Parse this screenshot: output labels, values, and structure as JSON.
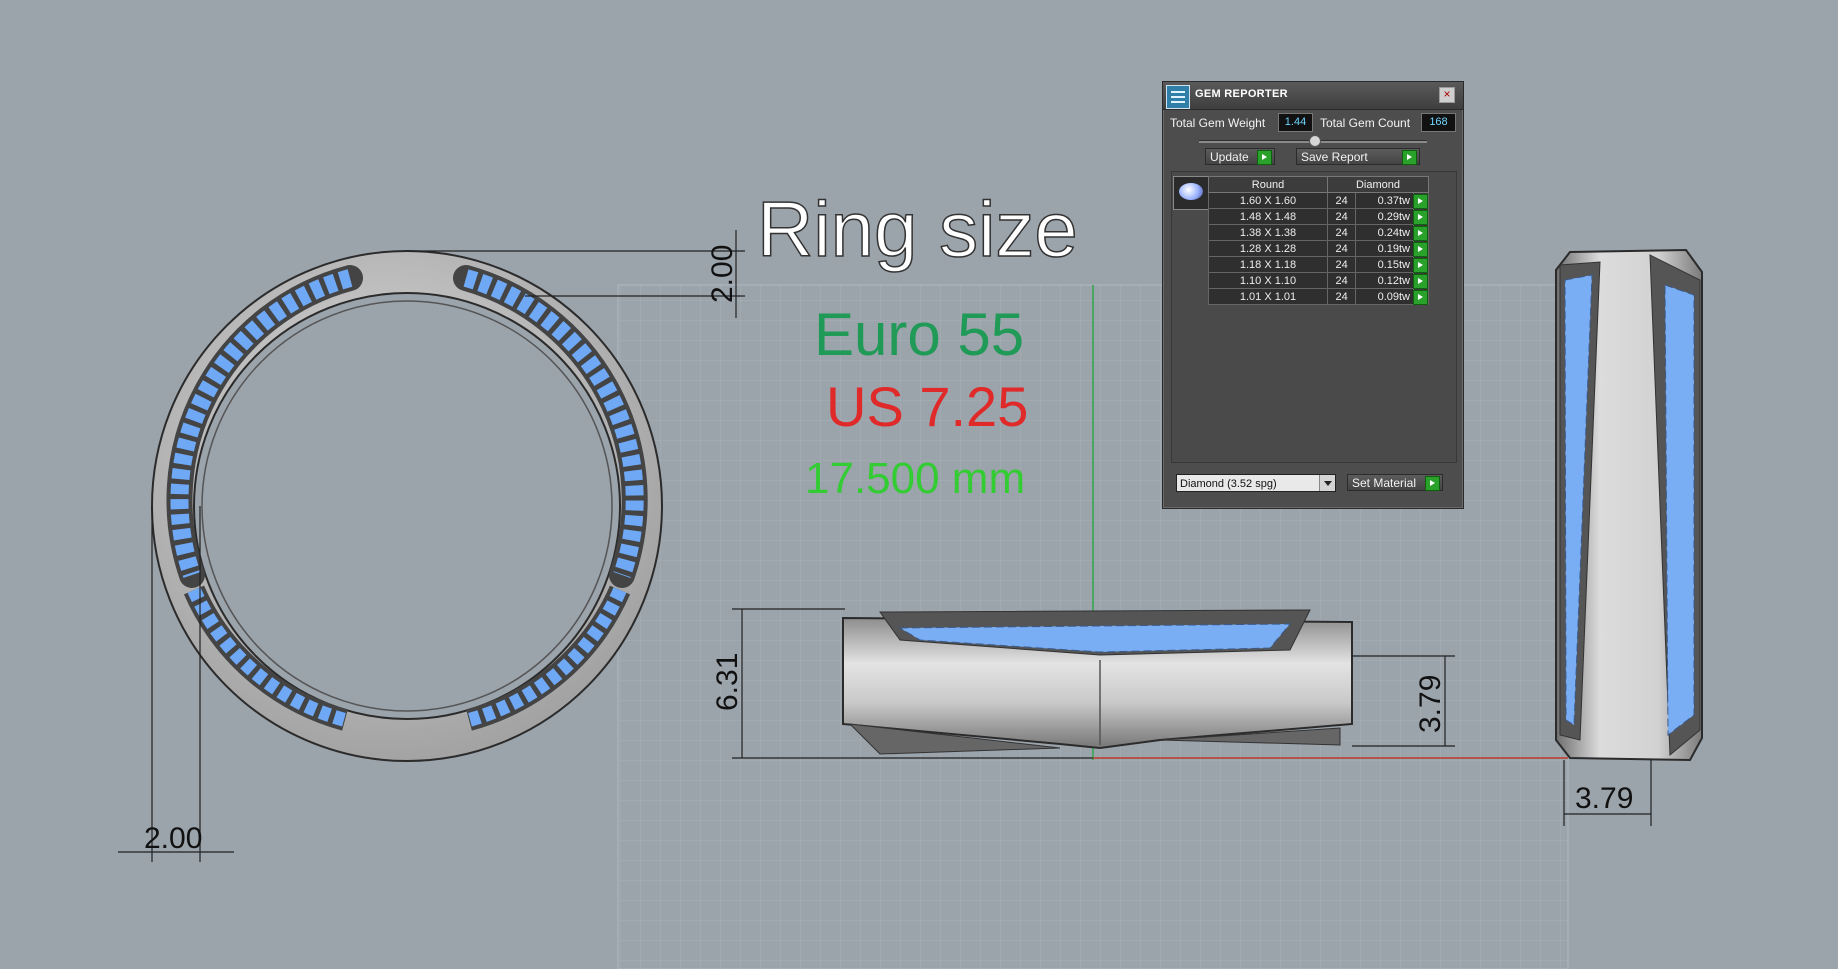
{
  "viewport": {
    "title_text": "Ring size",
    "euro_size": "Euro 55",
    "us_size": "US 7.25",
    "diameter": "17.500 mm",
    "colors": {
      "euro": "#1f9a57",
      "us": "#e02a2a",
      "diameter": "#33cc33",
      "background": "#9ba3ab"
    },
    "dimensions": {
      "top_wall": "2.00",
      "front_width": "2.00",
      "height": "6.31",
      "side_height": "3.79",
      "side_width": "3.79"
    }
  },
  "gem_reporter": {
    "title": "GEM REPORTER",
    "total_weight_label": "Total Gem Weight",
    "total_weight_value": "1.44",
    "total_count_label": "Total Gem Count",
    "total_count_value": "168",
    "update_label": "Update",
    "save_report_label": "Save Report",
    "table": {
      "headers": [
        "Round",
        "Diamond"
      ],
      "rows": [
        {
          "size": "1.60 X 1.60",
          "count": "24",
          "tw": "0.37tw"
        },
        {
          "size": "1.48 X 1.48",
          "count": "24",
          "tw": "0.29tw"
        },
        {
          "size": "1.38 X 1.38",
          "count": "24",
          "tw": "0.24tw"
        },
        {
          "size": "1.28 X 1.28",
          "count": "24",
          "tw": "0.19tw"
        },
        {
          "size": "1.18 X 1.18",
          "count": "24",
          "tw": "0.15tw"
        },
        {
          "size": "1.10 X 1.10",
          "count": "24",
          "tw": "0.12tw"
        },
        {
          "size": "1.01 X 1.01",
          "count": "24",
          "tw": "0.09tw"
        }
      ]
    },
    "material_select": "Diamond    (3.52 spg)",
    "set_material_label": "Set Material"
  }
}
